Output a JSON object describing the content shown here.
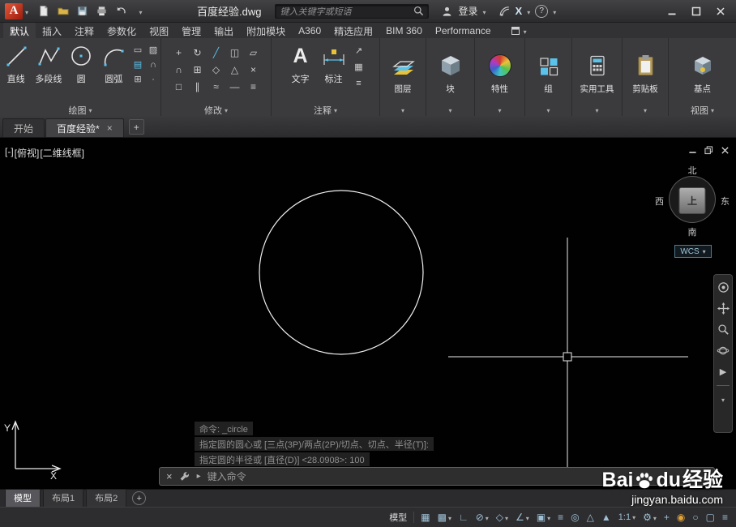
{
  "titlebar": {
    "logo_letter": "A",
    "filename": "百度经验.dwg",
    "search_placeholder": "键入关键字或短语",
    "signin": "登录",
    "exchange": "X",
    "help": "?"
  },
  "ribbon": {
    "tabs": [
      {
        "label": "默认"
      },
      {
        "label": "插入"
      },
      {
        "label": "注释"
      },
      {
        "label": "参数化"
      },
      {
        "label": "视图"
      },
      {
        "label": "管理"
      },
      {
        "label": "输出"
      },
      {
        "label": "附加模块"
      },
      {
        "label": "A360"
      },
      {
        "label": "精选应用"
      },
      {
        "label": "BIM 360"
      },
      {
        "label": "Performance"
      }
    ],
    "draw": {
      "line": "直线",
      "polyline": "多段线",
      "circle": "圆",
      "arc": "圆弧",
      "footer": "绘图"
    },
    "modify": {
      "footer": "修改"
    },
    "annotate": {
      "text": "文字",
      "dimension": "标注",
      "footer": "注释"
    },
    "layers": "图层",
    "block": "块",
    "properties": "特性",
    "group": "组",
    "utilities": "实用工具",
    "clipboard": "剪贴板",
    "basepoint": "基点",
    "view": "视图"
  },
  "file_tabs": {
    "start": "开始",
    "current": "百度经验*"
  },
  "viewport": {
    "vp_menu": "[-]",
    "vp_view": "[俯视]",
    "vp_style": "[二维线框]",
    "compass": {
      "n": "北",
      "s": "南",
      "e": "东",
      "w": "西",
      "face": "上"
    },
    "wcs": "WCS",
    "ucs_x": "X",
    "ucs_y": "Y"
  },
  "command": {
    "history": [
      "命令: _circle",
      "指定圆的圆心或 [三点(3P)/两点(2P)/切点、切点、半径(T)]:",
      "指定圆的半径或 [直径(D)] <28.0908>: 100"
    ],
    "placeholder": "键入命令"
  },
  "layout_tabs": {
    "model": "模型",
    "layout1": "布局1",
    "layout2": "布局2"
  },
  "statusbar": {
    "model": "模型",
    "scale": "1:1"
  },
  "watermark": {
    "p1": "Bai",
    "p2": "du",
    "p3": "经验",
    "url": "jingyan.baidu.com"
  }
}
